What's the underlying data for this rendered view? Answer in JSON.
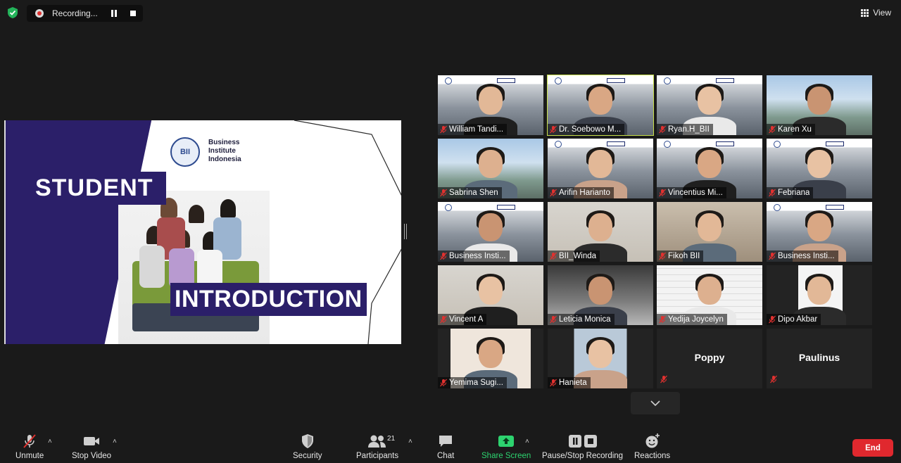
{
  "topbar": {
    "recording_label": "Recording...",
    "view_label": "View"
  },
  "slide": {
    "org_line1": "Business",
    "org_line2": "Institute",
    "org_line3": "Indonesia",
    "logo_text": "BII",
    "title_top": "STUDENT",
    "title_bottom": "INTRODUCTION"
  },
  "participants": [
    {
      "name": "William Tandi...",
      "bg": "kaplan",
      "muted": true
    },
    {
      "name": "Dr. Soebowo M...",
      "bg": "kaplan",
      "muted": false,
      "active": true
    },
    {
      "name": "Ryan.H_BII",
      "bg": "kaplan",
      "muted": false
    },
    {
      "name": "Karen Xu",
      "bg": "city",
      "muted": false
    },
    {
      "name": "Sabrina Shen",
      "bg": "city",
      "muted": true
    },
    {
      "name": "Arifin Harianto",
      "bg": "kaplan",
      "muted": true
    },
    {
      "name": "Vincentius Mi...",
      "bg": "kaplan",
      "muted": true
    },
    {
      "name": "Febriana",
      "bg": "kaplan",
      "muted": true
    },
    {
      "name": "Business Insti...",
      "bg": "kaplan",
      "muted": true
    },
    {
      "name": "BII_Winda",
      "bg": "room",
      "muted": true
    },
    {
      "name": "Fikoh BII",
      "bg": "warm",
      "muted": true
    },
    {
      "name": "Business Insti...",
      "bg": "kaplan",
      "muted": true
    },
    {
      "name": "Vincent A",
      "bg": "room",
      "muted": true
    },
    {
      "name": "Leticia Monica",
      "bg": "dark",
      "muted": true
    },
    {
      "name": "Yedija Joycelyn",
      "bg": "brick",
      "muted": true
    },
    {
      "name": "Dipo Akbar",
      "bg": "plainvideo",
      "muted": true
    },
    {
      "name": "Yemima Sugi...",
      "bg": "room",
      "muted": true
    },
    {
      "name": "Hanieta",
      "bg": "city",
      "muted": true
    },
    {
      "name": "Poppy",
      "bg": "none",
      "muted": true
    },
    {
      "name": "Paulinus",
      "bg": "none",
      "muted": true
    }
  ],
  "toolbar": {
    "unmute": "Unmute",
    "stop_video": "Stop Video",
    "security": "Security",
    "participants": "Participants",
    "participant_count": "21",
    "chat": "Chat",
    "share_screen": "Share Screen",
    "pause_stop_recording": "Pause/Stop Recording",
    "reactions": "Reactions",
    "end": "End"
  },
  "colors": {
    "accent_green": "#2dd36f",
    "end_red": "#e0282e",
    "slide_purple": "#2b1f69",
    "active_speaker": "#c8e04a"
  }
}
